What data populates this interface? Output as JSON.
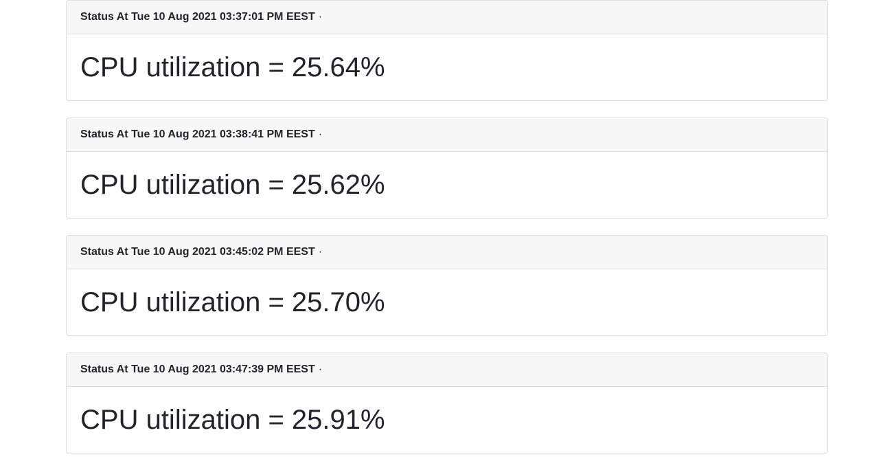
{
  "cards": [
    {
      "status": "Status At Tue 10 Aug 2021 03:37:01 PM EEST",
      "separator": "·",
      "reading": "CPU utilization = 25.64%"
    },
    {
      "status": "Status At Tue 10 Aug 2021 03:38:41 PM EEST",
      "separator": "·",
      "reading": "CPU utilization = 25.62%"
    },
    {
      "status": "Status At Tue 10 Aug 2021 03:45:02 PM EEST",
      "separator": "·",
      "reading": "CPU utilization = 25.70%"
    },
    {
      "status": "Status At Tue 10 Aug 2021 03:47:39 PM EEST",
      "separator": "·",
      "reading": "CPU utilization = 25.91%"
    }
  ]
}
